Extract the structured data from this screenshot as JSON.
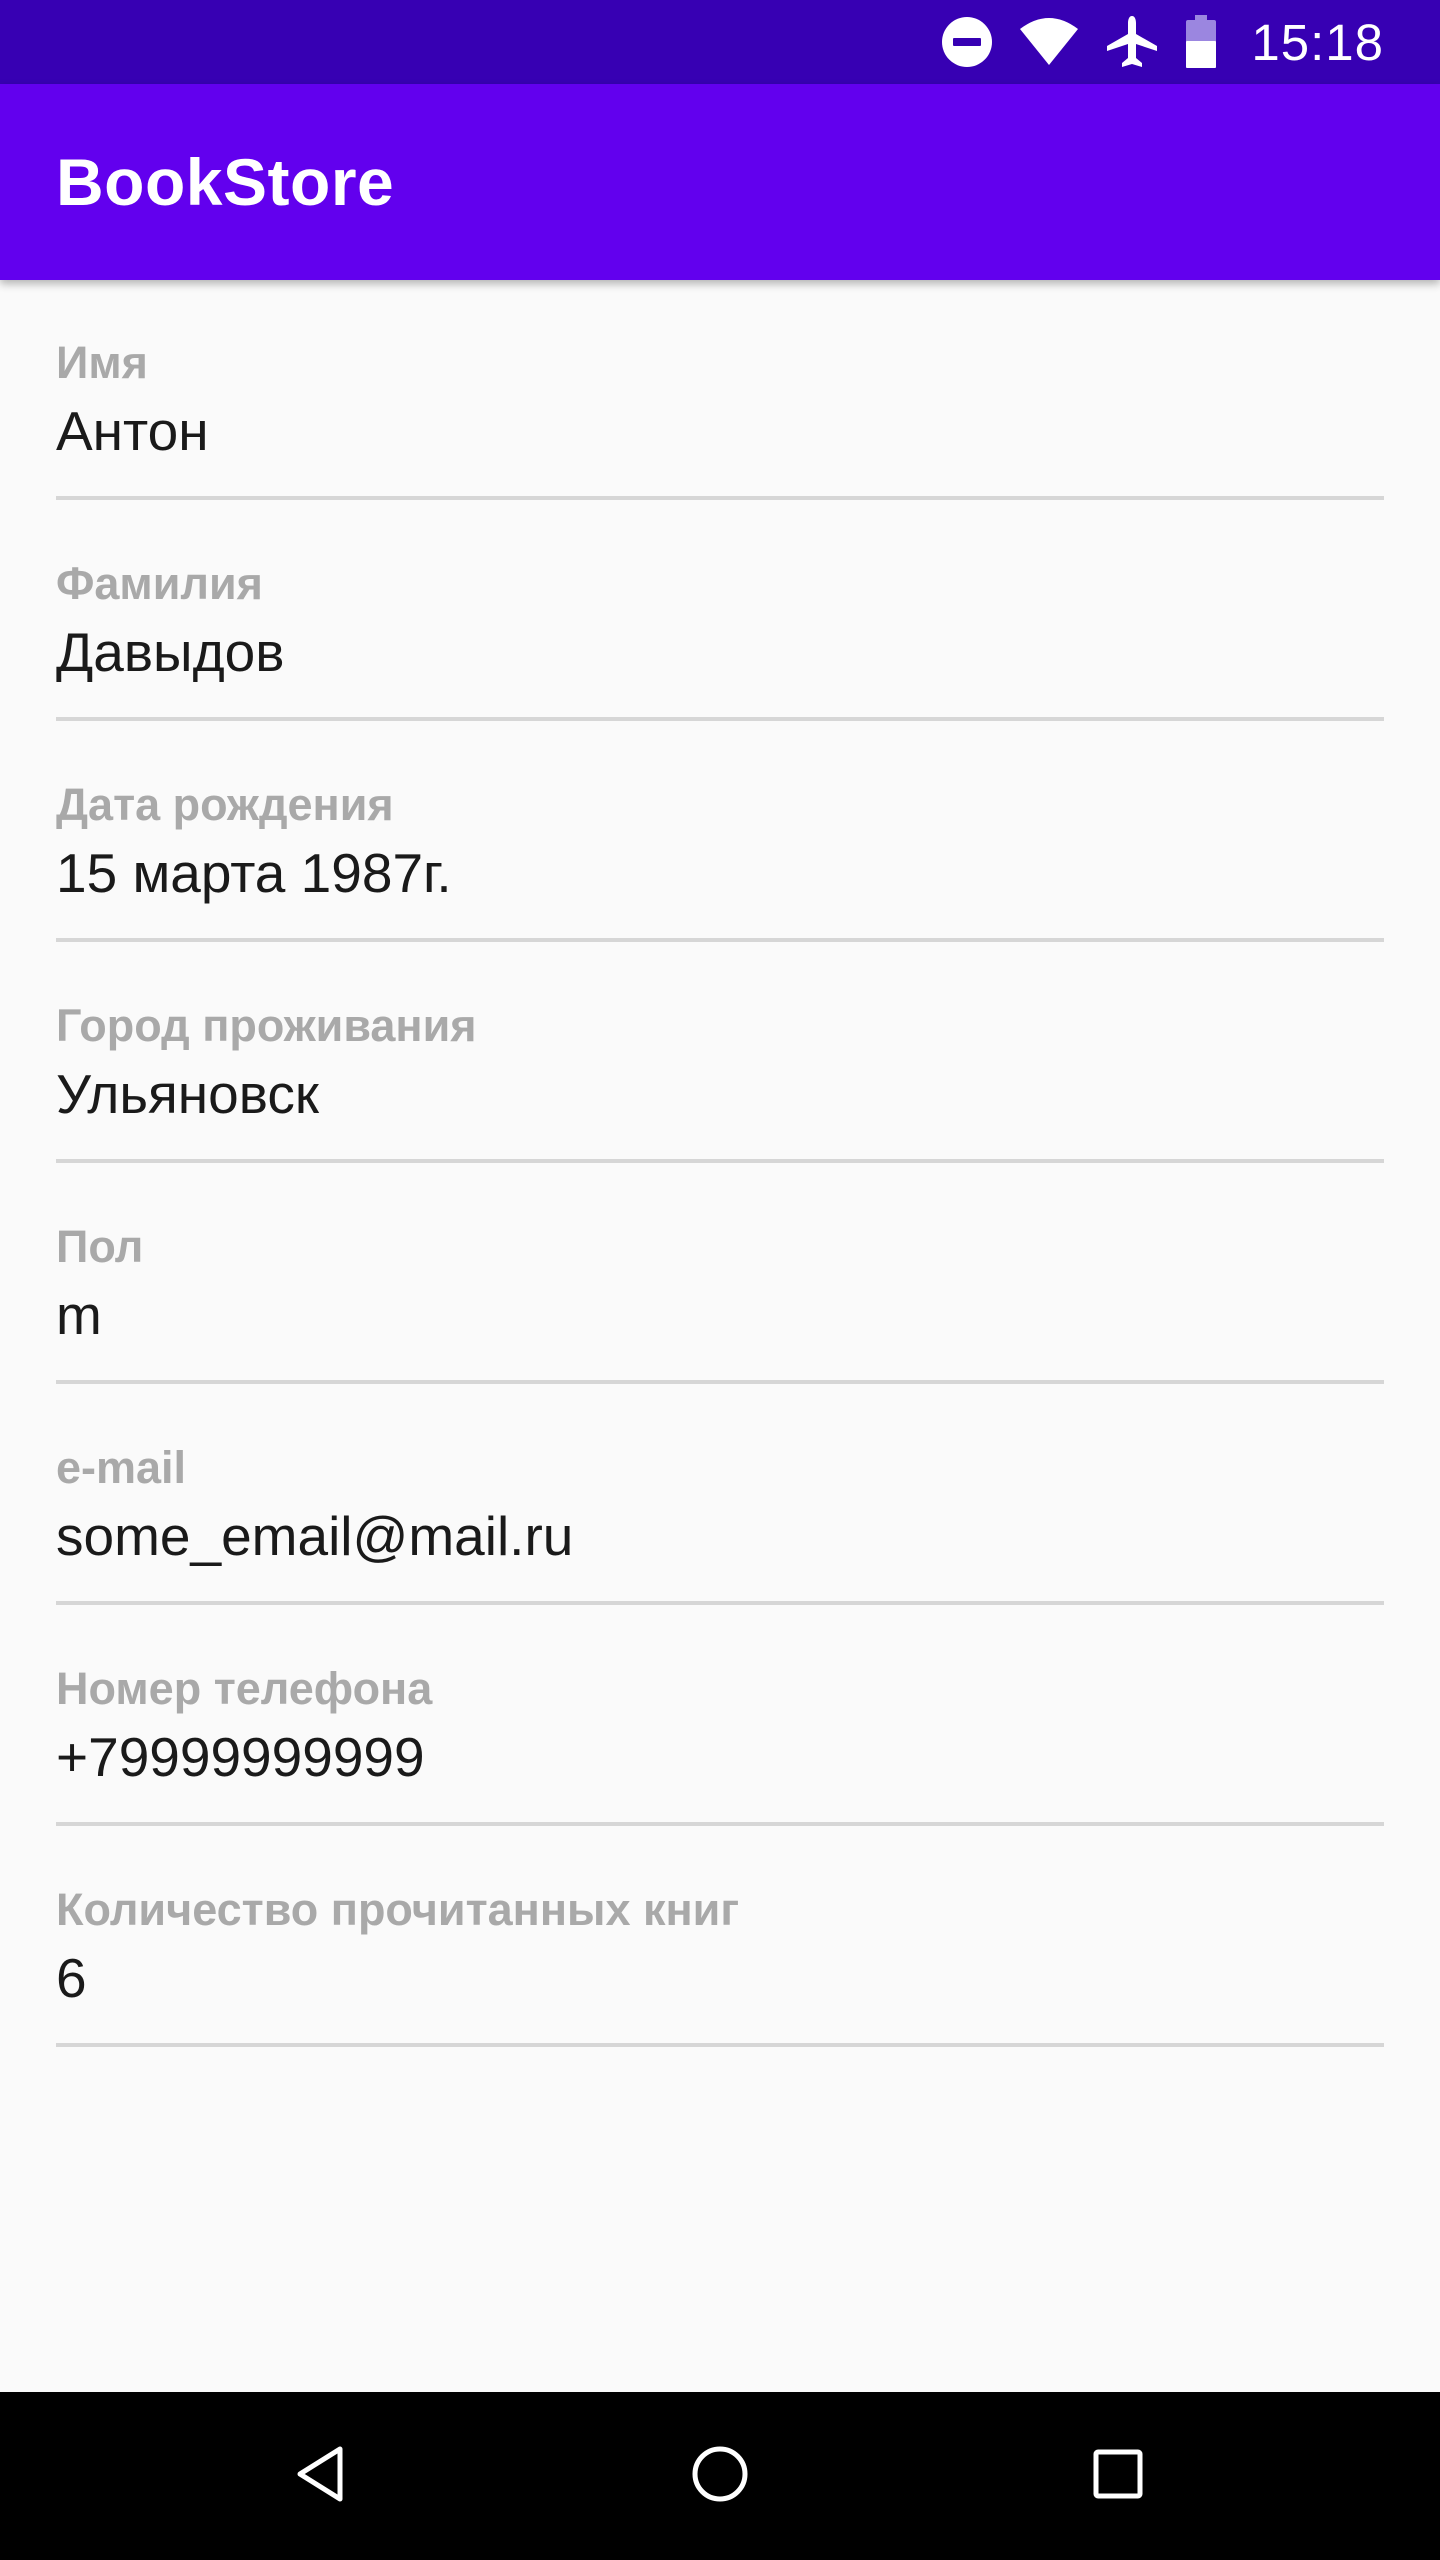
{
  "status_bar": {
    "time": "15:18",
    "icons": [
      "do-not-disturb-icon",
      "wifi-icon",
      "airplane-icon",
      "battery-icon"
    ]
  },
  "app_bar": {
    "title": "BookStore"
  },
  "form": {
    "fields": [
      {
        "label": "Имя",
        "value": "Антон"
      },
      {
        "label": "Фамилия",
        "value": "Давыдов"
      },
      {
        "label": "Дата рождения",
        "value": "15 марта 1987г."
      },
      {
        "label": "Город проживания",
        "value": "Ульяновск"
      },
      {
        "label": "Пол",
        "value": "m"
      },
      {
        "label": "e-mail",
        "value": "some_email@mail.ru"
      },
      {
        "label": "Номер телефона",
        "value": "+79999999999"
      },
      {
        "label": "Количество прочитанных книг",
        "value": "6"
      }
    ]
  },
  "nav_bar": {
    "buttons": [
      "back-icon",
      "home-icon",
      "recents-icon"
    ]
  },
  "colors": {
    "status_bar": "#3700b3",
    "app_bar": "#6200ee",
    "background": "#fafafa",
    "label": "#a9a9a9",
    "value": "#1a1a1a",
    "underline": "#d6d6d6"
  }
}
